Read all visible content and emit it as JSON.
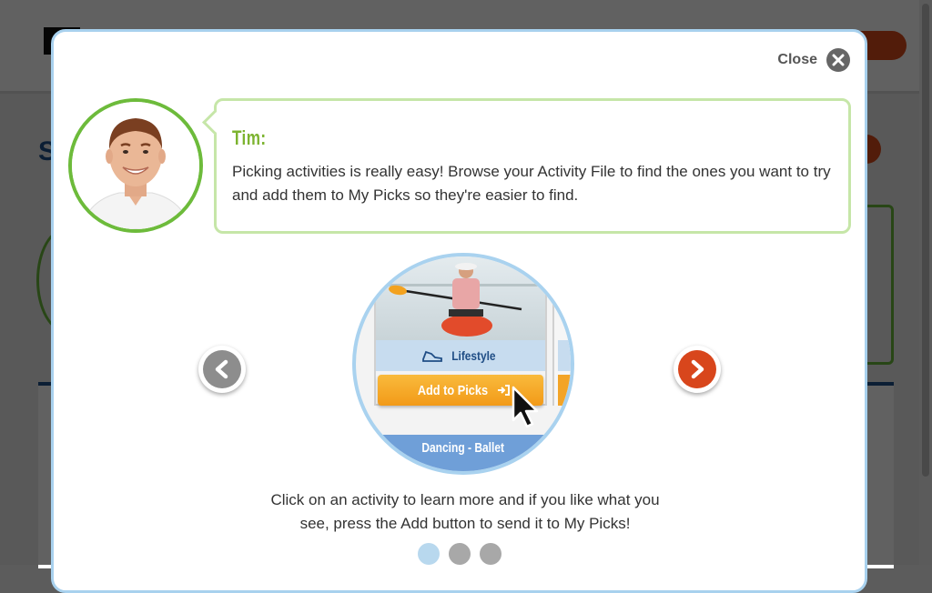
{
  "modal": {
    "close_label": "Close",
    "speaker": "Tim:",
    "message": "Picking activities is really easy! Browse your Activity File to find the ones you want to try and add them to My Picks so they're easier to find.",
    "caption": "Click on an activity to learn more and if you like what you see, press the Add button to send it to My Picks!",
    "illustration": {
      "category_label": "Lifestyle",
      "button_label": "Add to Picks",
      "next_card_label": "Dancing - Ballet"
    },
    "pagination": {
      "total": 3,
      "current": 1
    }
  },
  "colors": {
    "accent_green": "#7cb32f",
    "accent_blue": "#a9d2ef",
    "next_button": "#d8461c",
    "prev_button": "#8d8d8d",
    "add_button": "#f29a18"
  }
}
